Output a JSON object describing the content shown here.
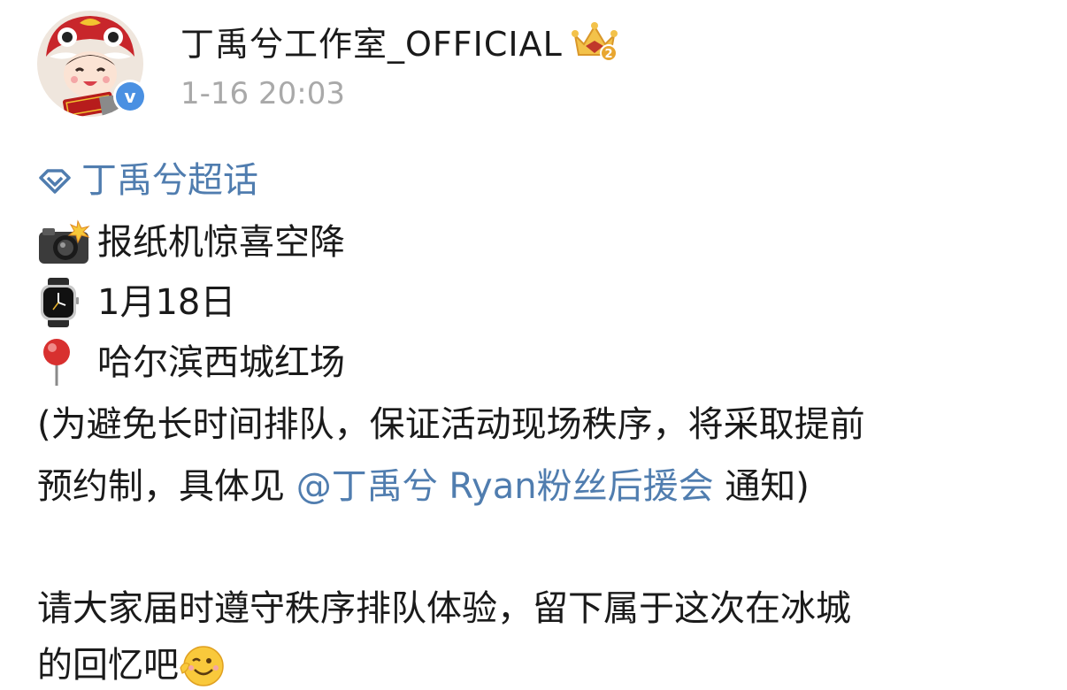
{
  "header": {
    "username": "丁禹兮工作室_OFFICIAL",
    "timestamp": "1-16 20:03",
    "verified_mark": "v",
    "icons": [
      "avatar",
      "verified-badge-icon",
      "crown-level-icon"
    ]
  },
  "post": {
    "topic": "丁禹兮超话",
    "line1": "报纸机惊喜空降",
    "line2": "1月18日",
    "line3": "哈尔滨西城红场",
    "line4": "(为避免长时间排队，保证活动现场秩序，将采取提前",
    "line5_pre": "预约制，具体见 ",
    "mention": "@丁禹兮 Ryan粉丝后援会",
    "line5_post": " 通知)",
    "line6": "请大家届时遵守秩序排队体验，留下属于这次在冰城",
    "line7": "的回忆吧",
    "emoji_icons": [
      "diamond-topic-icon",
      "camera-flash-icon",
      "watch-icon",
      "pushpin-icon",
      "wink-face-icon"
    ]
  },
  "colors": {
    "link": "#507daf",
    "text": "#1a1a1a",
    "timestamp": "#a9a9a9",
    "verified": "#4a90e2"
  }
}
